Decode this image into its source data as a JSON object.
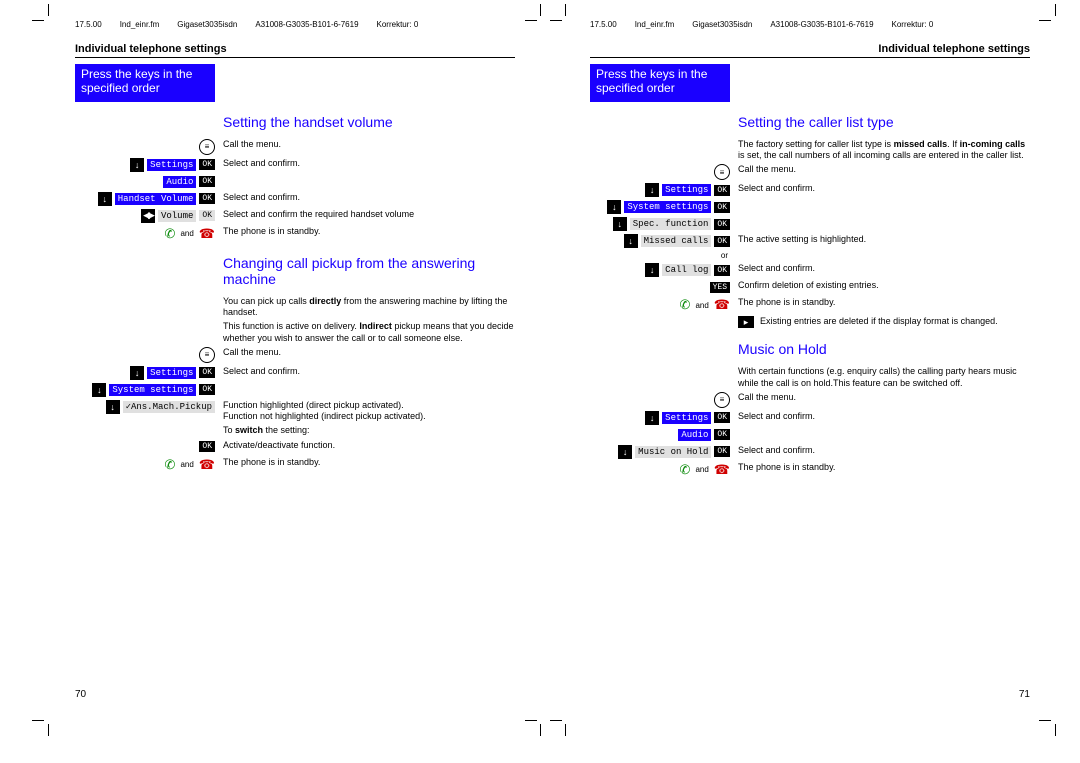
{
  "crop_marks": true,
  "meta": {
    "date": "17.5.00",
    "file": "Ind_einr.fm",
    "product": "Gigaset3035isdn",
    "doc_id": "A31008-G3035-B101-6-7619",
    "korrektur": "Korrektur: 0"
  },
  "section_title": "Individual telephone settings",
  "press_box": "Press the keys in the specified order",
  "left": {
    "h1": "Setting the handset volume",
    "r1": "Call the menu.",
    "m1": "Settings",
    "r2": "Select and confirm.",
    "m2": "Audio",
    "m3": "Handset Volume",
    "r3": "Select and confirm.",
    "m4": "Volume",
    "r4": "Select and confirm the required handset volume",
    "r5_and": "and",
    "r5": "The phone is in standby.",
    "h2": "Changing call pickup from the answering machine",
    "p1a": "You can pick up calls ",
    "p1b": "directly",
    "p1c": " from the answering machine by lifting the handset.",
    "p2a": "This function is active on delivery. ",
    "p2b": "Indirect",
    "p2c": " pickup means that you decide whether you wish to answer the call or to call someone else.",
    "r6": "Call the menu.",
    "m5": "Settings",
    "r7": "Select and confirm.",
    "m6": "System settings",
    "m7": "✓Ans.Mach.Pickup",
    "r8": "Function highlighted (direct pickup activated).\nFunction not highlighted (indirect pickup activated).",
    "p3a": "To ",
    "p3b": "switch",
    "p3c": " the setting:",
    "r9": "Activate/deactivate function.",
    "r10_and": "and",
    "r10": "The phone is in standby.",
    "page_num": "70"
  },
  "right": {
    "h1": "Setting the caller list type",
    "p1a": "The factory setting for caller list type is ",
    "p1b": "missed calls",
    "p1c": ". If ",
    "p1d": "in-coming calls",
    "p1e": " is set, the call numbers of all incoming calls are entered in the caller list.",
    "r1": "Call the menu.",
    "m1": "Settings",
    "r2": "Select and confirm.",
    "m2": "System settings",
    "m3": "Spec. function",
    "m4": "Missed calls",
    "r3": "The active setting is highlighted.",
    "or": "or",
    "m5": "Call log",
    "r4": "Select and confirm.",
    "yes": "YES",
    "r5": "Confirm deletion of existing entries.",
    "r6_and": "and",
    "r6": "The phone is in standby.",
    "note": "Existing entries are deleted if the display format is changed.",
    "h2": "Music on Hold",
    "p2": "With certain functions (e.g. enquiry calls) the calling party hears music while the call is on hold.This feature can be switched off.",
    "r7": "Call the menu.",
    "m6": "Settings",
    "r8": "Select and confirm.",
    "m7": "Audio",
    "m8": "Music on Hold",
    "r9": "Select and confirm.",
    "r10_and": "and",
    "r10": "The phone is in standby.",
    "page_num": "71"
  },
  "ok_label": "OK"
}
